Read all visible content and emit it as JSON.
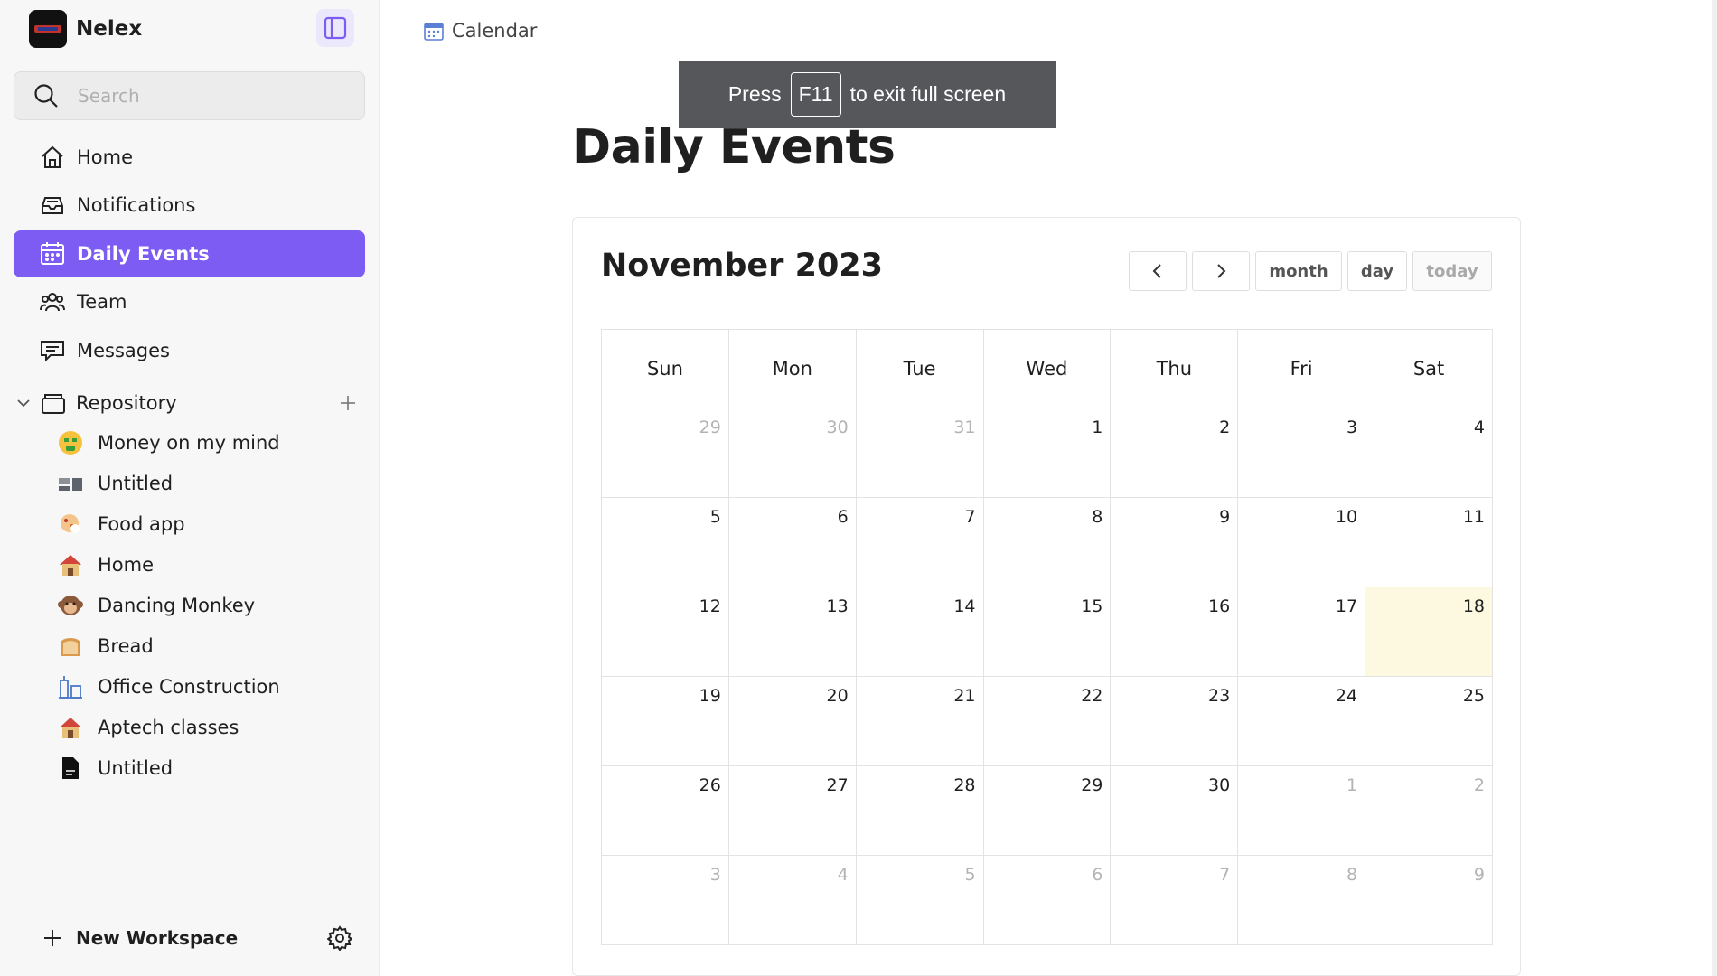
{
  "workspace": {
    "name": "Nelex"
  },
  "search": {
    "placeholder": "Search"
  },
  "nav": [
    {
      "label": "Home",
      "icon": "home-icon"
    },
    {
      "label": "Notifications",
      "icon": "inbox-icon"
    },
    {
      "label": "Daily Events",
      "icon": "calendar-icon",
      "active": true
    },
    {
      "label": "Team",
      "icon": "team-icon"
    },
    {
      "label": "Messages",
      "icon": "message-icon"
    }
  ],
  "repository": {
    "label": "Repository",
    "pages": [
      {
        "label": "Money on my mind",
        "icon": "money-face-icon"
      },
      {
        "label": "Untitled",
        "icon": "blocks-icon"
      },
      {
        "label": "Food app",
        "icon": "cookie-icon"
      },
      {
        "label": "Home",
        "icon": "house-icon"
      },
      {
        "label": "Dancing Monkey",
        "icon": "monkey-icon"
      },
      {
        "label": "Bread",
        "icon": "bread-icon"
      },
      {
        "label": "Office Construction",
        "icon": "building-icon"
      },
      {
        "label": "Aptech classes",
        "icon": "house-icon"
      },
      {
        "label": "Untitled",
        "icon": "document-icon"
      }
    ]
  },
  "footer": {
    "new_workspace_label": "New Workspace"
  },
  "breadcrumb": {
    "label": "Calendar"
  },
  "fullscreen_toast": {
    "prefix": "Press",
    "key": "F11",
    "suffix": "to exit full screen"
  },
  "page": {
    "title": "Daily Events"
  },
  "calendar": {
    "title": "November 2023",
    "buttons": {
      "month": "month",
      "day": "day",
      "today": "today"
    },
    "weekdays": [
      "Sun",
      "Mon",
      "Tue",
      "Wed",
      "Thu",
      "Fri",
      "Sat"
    ],
    "weeks": [
      [
        "29",
        "30",
        "31",
        "1",
        "2",
        "3",
        "4"
      ],
      [
        "5",
        "6",
        "7",
        "8",
        "9",
        "10",
        "11"
      ],
      [
        "12",
        "13",
        "14",
        "15",
        "16",
        "17",
        "18"
      ],
      [
        "19",
        "20",
        "21",
        "22",
        "23",
        "24",
        "25"
      ],
      [
        "26",
        "27",
        "28",
        "29",
        "30",
        "1",
        "2"
      ],
      [
        "3",
        "4",
        "5",
        "6",
        "7",
        "8",
        "9"
      ]
    ],
    "today": "18",
    "colors": {
      "active_nav": "#7c5cf2",
      "today_highlight": "#fdf9e1"
    }
  }
}
